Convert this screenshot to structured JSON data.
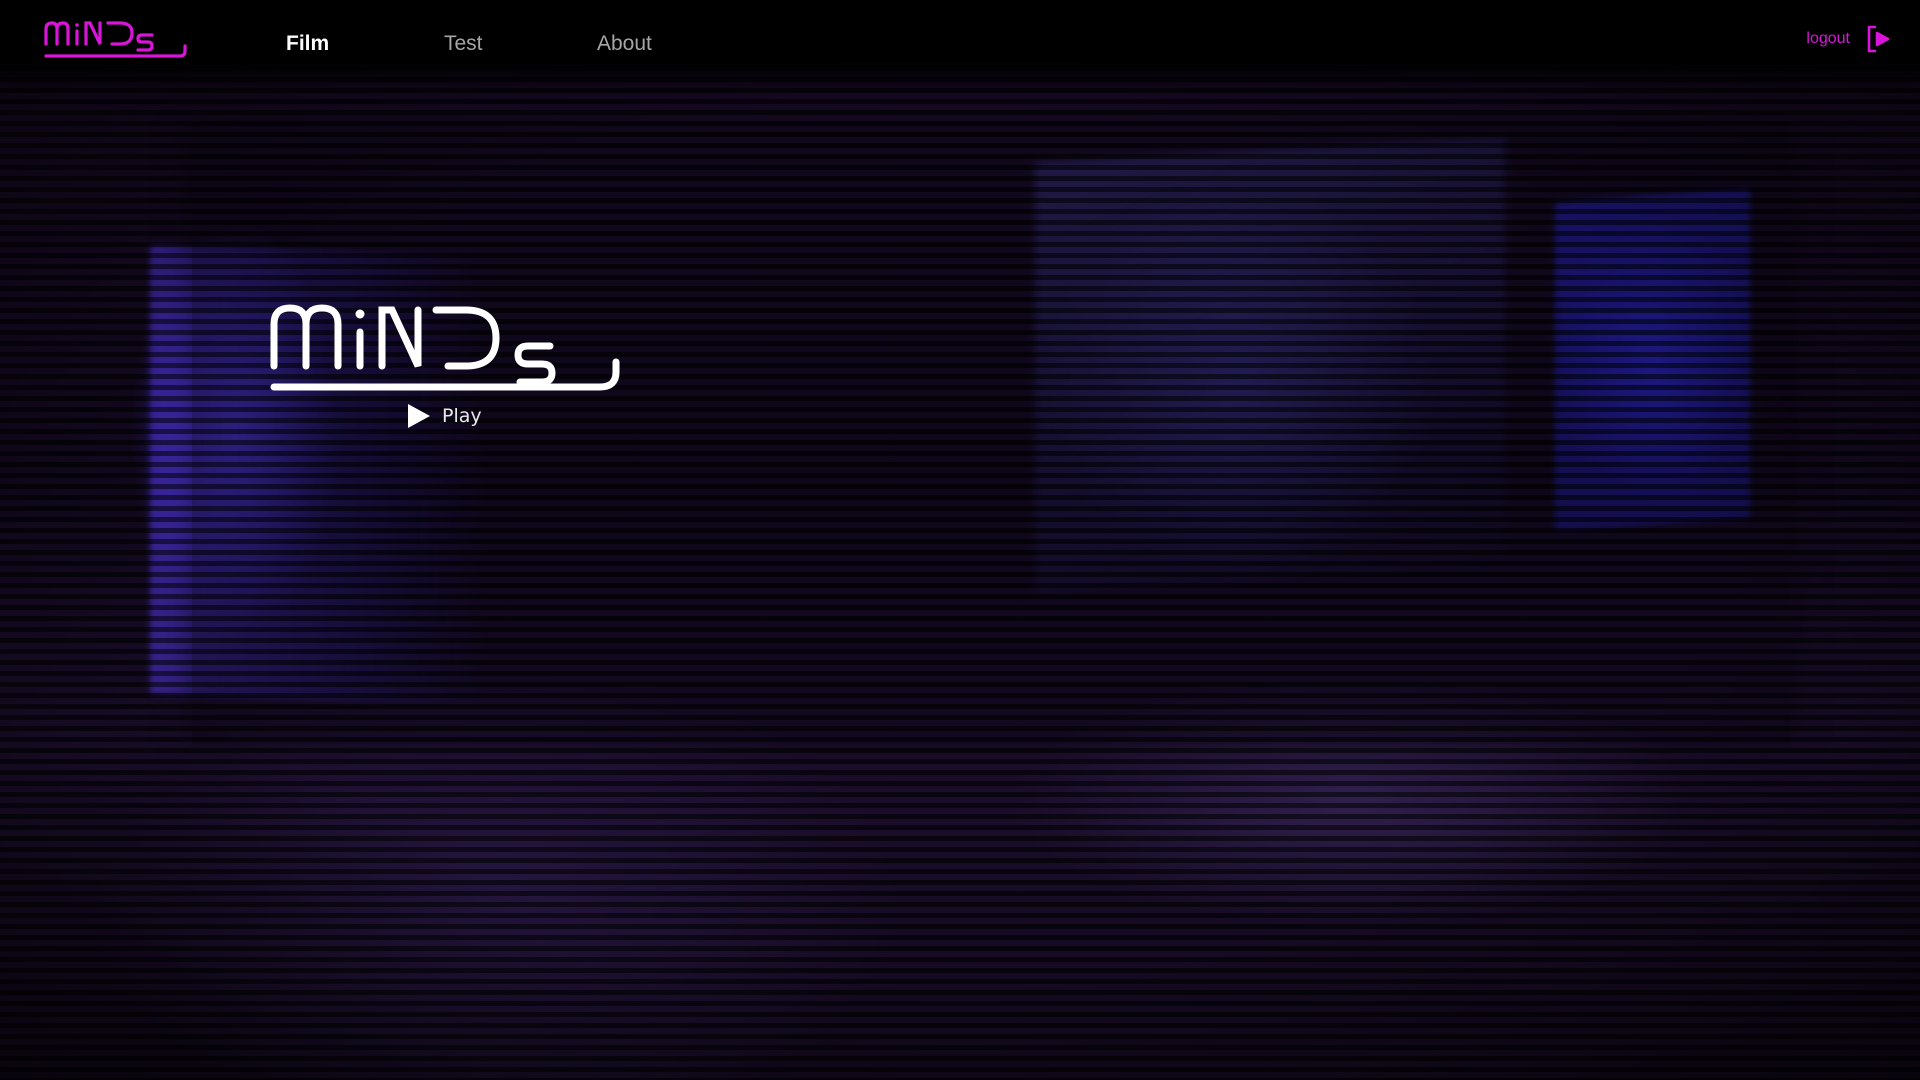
{
  "brand": {
    "logo_text": "miNDs",
    "accent_color": "#d815d8"
  },
  "nav": {
    "items": [
      {
        "label": "Film",
        "active": true
      },
      {
        "label": "Test",
        "active": false
      },
      {
        "label": "About",
        "active": false
      }
    ]
  },
  "account": {
    "logout_label": "logout",
    "logout_icon": "logout-arrow-icon"
  },
  "hero": {
    "logo_text": "miNDs",
    "play_label": "Play",
    "play_icon": "play-triangle-icon"
  },
  "colors": {
    "header_bg": "#000000",
    "nav_active": "#ffffff",
    "nav_inactive": "#a6a6a6",
    "hero_text": "#ffffff"
  }
}
